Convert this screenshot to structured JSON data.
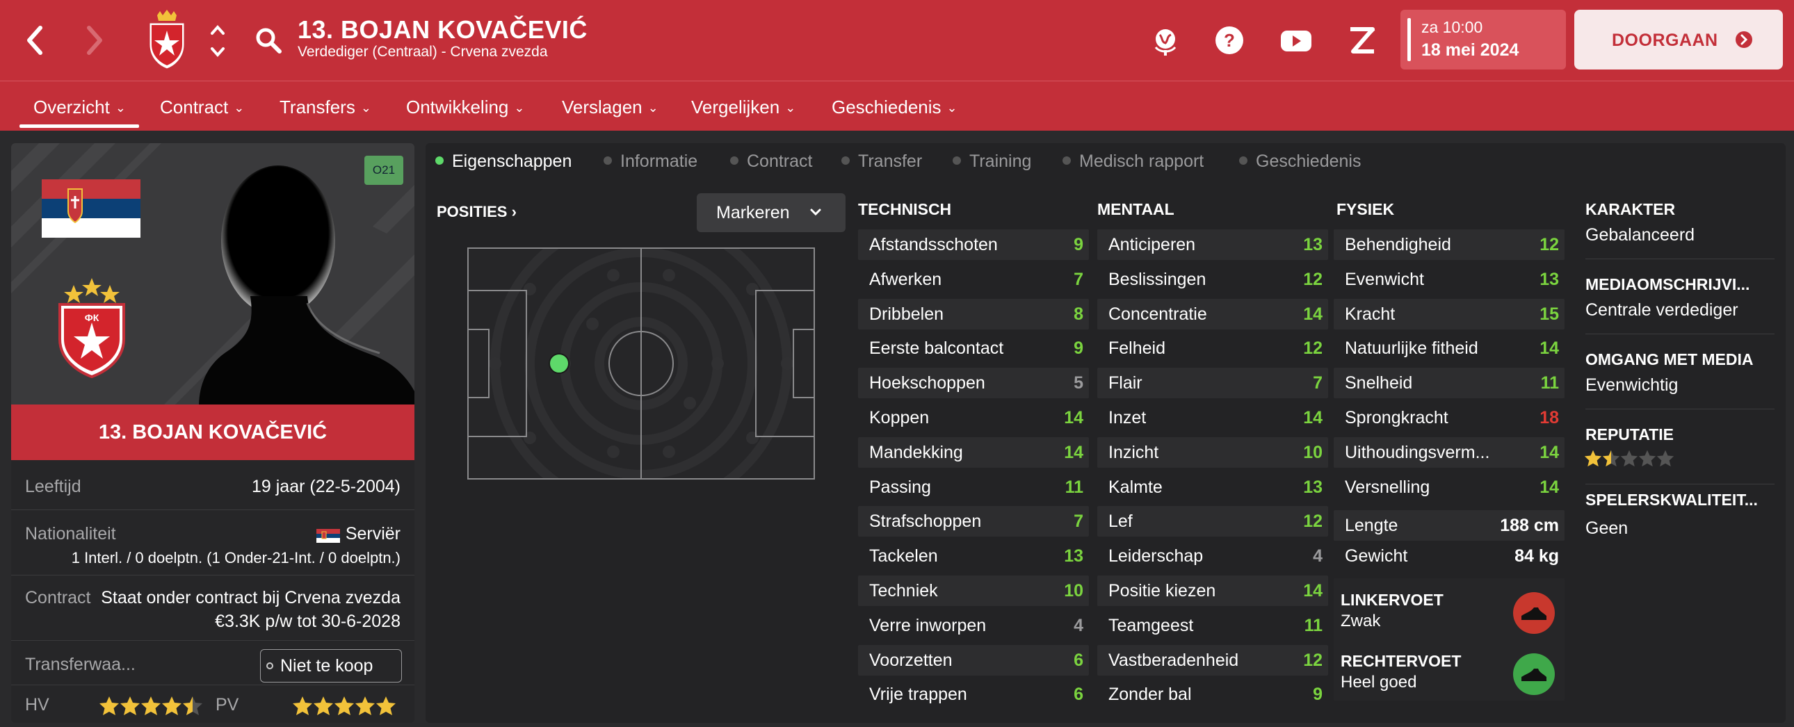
{
  "header": {
    "player_title": "13. BOJAN KOVAČEVIĆ",
    "player_subtitle": "Verdediger (Centraal) - Crvena zvezda",
    "date_time": "za 10:00",
    "date_day": "18 mei 2024",
    "continue_label": "DOORGAAN",
    "icons": [
      "back-icon",
      "forward-icon",
      "club-crest-icon",
      "up-down-icon",
      "search-icon",
      "globe-icon",
      "help-icon",
      "youtube-icon",
      "zen-icon",
      "arrow-right-icon"
    ]
  },
  "main_tabs": [
    {
      "label": "Overzicht"
    },
    {
      "label": "Contract"
    },
    {
      "label": "Transfers"
    },
    {
      "label": "Ontwikkeling"
    },
    {
      "label": "Verslagen"
    },
    {
      "label": "Vergelijken"
    },
    {
      "label": "Geschiedenis"
    }
  ],
  "card": {
    "badge": "O21",
    "name": "13. BOJAN KOVAČEVIĆ",
    "age_label": "Leeftijd",
    "age_value": "19 jaar (22-5-2004)",
    "nationality_label": "Nationaliteit",
    "nationality_value": "Serviër",
    "caps_value": "1 Interl. / 0 doelptn. (1 Onder-21-Int. / 0 doelptn.)",
    "contract_label": "Contract",
    "contract_line1": "Staat onder contract bij Crvena zvezda",
    "contract_line2": "€3.3K p/w tot 30-6-2028",
    "transfer_label": "Transferwaa...",
    "transfer_value": "Niet te koop",
    "hv_label": "HV",
    "hv_stars": 4.5,
    "pv_label": "PV",
    "pv_stars": 5
  },
  "sub_tabs": [
    {
      "label": "Eigenschappen",
      "active": true
    },
    {
      "label": "Informatie"
    },
    {
      "label": "Contract"
    },
    {
      "label": "Transfer"
    },
    {
      "label": "Training"
    },
    {
      "label": "Medisch rapport"
    },
    {
      "label": "Geschiedenis"
    }
  ],
  "positions": {
    "title": "POSITIES",
    "mark_label": "Markeren"
  },
  "technical": {
    "title": "TECHNISCH",
    "items": [
      {
        "name": "Afstandsschoten",
        "value": "9",
        "color": "green"
      },
      {
        "name": "Afwerken",
        "value": "7",
        "color": "green"
      },
      {
        "name": "Dribbelen",
        "value": "8",
        "color": "green"
      },
      {
        "name": "Eerste balcontact",
        "value": "9",
        "color": "green"
      },
      {
        "name": "Hoekschoppen",
        "value": "5",
        "color": "grey"
      },
      {
        "name": "Koppen",
        "value": "14",
        "color": "green"
      },
      {
        "name": "Mandekking",
        "value": "14",
        "color": "green"
      },
      {
        "name": "Passing",
        "value": "11",
        "color": "green"
      },
      {
        "name": "Strafschoppen",
        "value": "7",
        "color": "green"
      },
      {
        "name": "Tackelen",
        "value": "13",
        "color": "green"
      },
      {
        "name": "Techniek",
        "value": "10",
        "color": "green"
      },
      {
        "name": "Verre inworpen",
        "value": "4",
        "color": "grey"
      },
      {
        "name": "Voorzetten",
        "value": "6",
        "color": "green"
      },
      {
        "name": "Vrije trappen",
        "value": "6",
        "color": "green"
      }
    ]
  },
  "mental": {
    "title": "MENTAAL",
    "items": [
      {
        "name": "Anticiperen",
        "value": "13",
        "color": "green"
      },
      {
        "name": "Beslissingen",
        "value": "12",
        "color": "green"
      },
      {
        "name": "Concentratie",
        "value": "14",
        "color": "green"
      },
      {
        "name": "Felheid",
        "value": "12",
        "color": "green"
      },
      {
        "name": "Flair",
        "value": "7",
        "color": "green"
      },
      {
        "name": "Inzet",
        "value": "14",
        "color": "green"
      },
      {
        "name": "Inzicht",
        "value": "10",
        "color": "green"
      },
      {
        "name": "Kalmte",
        "value": "13",
        "color": "green"
      },
      {
        "name": "Lef",
        "value": "12",
        "color": "green"
      },
      {
        "name": "Leiderschap",
        "value": "4",
        "color": "grey"
      },
      {
        "name": "Positie kiezen",
        "value": "14",
        "color": "green"
      },
      {
        "name": "Teamgeest",
        "value": "11",
        "color": "green"
      },
      {
        "name": "Vastberadenheid",
        "value": "12",
        "color": "green"
      },
      {
        "name": "Zonder bal",
        "value": "9",
        "color": "green"
      }
    ]
  },
  "physical": {
    "title": "FYSIEK",
    "items": [
      {
        "name": "Behendigheid",
        "value": "12",
        "color": "green"
      },
      {
        "name": "Evenwicht",
        "value": "13",
        "color": "green"
      },
      {
        "name": "Kracht",
        "value": "15",
        "color": "green"
      },
      {
        "name": "Natuurlijke fitheid",
        "value": "14",
        "color": "green"
      },
      {
        "name": "Snelheid",
        "value": "11",
        "color": "green"
      },
      {
        "name": "Sprongkracht",
        "value": "18",
        "color": "red"
      },
      {
        "name": "Uithoudingsverm...",
        "value": "14",
        "color": "green"
      },
      {
        "name": "Versnelling",
        "value": "14",
        "color": "green"
      }
    ],
    "length_label": "Lengte",
    "length_value": "188 cm",
    "weight_label": "Gewicht",
    "weight_value": "84 kg"
  },
  "feet": {
    "left_label": "LINKERVOET",
    "left_value": "Zwak",
    "left_color": "#c8382d",
    "right_label": "RECHTERVOET",
    "right_value": "Heel goed",
    "right_color": "#3fa84a"
  },
  "side": {
    "character_title": "KARAKTER",
    "character_value": "Gebalanceerd",
    "media_title": "MEDIAOMSCHRIJVI...",
    "media_value": "Centrale verdediger",
    "media_handling_title": "OMGANG MET MEDIA",
    "media_handling_value": "Evenwichtig",
    "reputation_title": "REPUTATIE",
    "reputation_stars": 1.5,
    "quality_title": "SPELERSKWALITEIT...",
    "quality_value": "Geen"
  },
  "colors": {
    "brand_red": "#c32f39",
    "attr_green": "#7bd43f",
    "attr_red": "#e23b34",
    "star_gold": "#f2c23a"
  }
}
